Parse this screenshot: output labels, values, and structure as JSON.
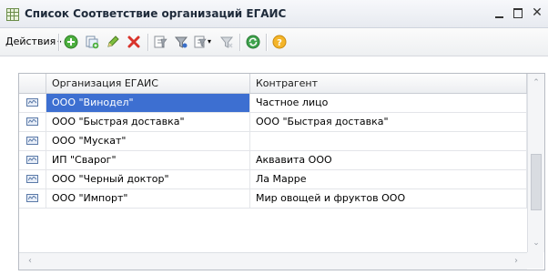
{
  "window": {
    "title": "Список Соответствие организаций ЕГАИС",
    "minimize_icon": "minimize-icon",
    "maximize_icon": "maximize-icon",
    "close_glyph": "✕"
  },
  "toolbar": {
    "actions_label": "Действия",
    "actions_caret": "▾",
    "icons": [
      "add-icon",
      "copy-icon",
      "edit-icon",
      "delete-icon",
      "set-filter-icon",
      "filter-icon",
      "filter-dropdown-icon",
      "clear-filter-icon",
      "refresh-icon",
      "help-icon"
    ]
  },
  "table": {
    "columns": [
      "Организация ЕГАИС",
      "Контрагент"
    ],
    "rows": [
      {
        "org": "ООО \"Винодел\"",
        "counterparty": "Частное лицо",
        "selected": true
      },
      {
        "org": "ООО \"Быстрая доставка\"",
        "counterparty": "ООО \"Быстрая доставка\"",
        "selected": false
      },
      {
        "org": "ООО \"Мускат\"",
        "counterparty": "",
        "selected": false
      },
      {
        "org": "ИП \"Сварог\"",
        "counterparty": "Аквавита ООО",
        "selected": false
      },
      {
        "org": "ООО \"Черный доктор\"",
        "counterparty": "Ла Марре",
        "selected": false
      },
      {
        "org": "ООО \"Импорт\"",
        "counterparty": "Мир овощей и фруктов ООО",
        "selected": false
      }
    ],
    "row_icon": "catalog-item-icon",
    "selected_color": "#3d6fd1"
  },
  "scrollbars": {
    "up": "⌃",
    "down": "⌄",
    "left": "‹",
    "right": "›"
  }
}
